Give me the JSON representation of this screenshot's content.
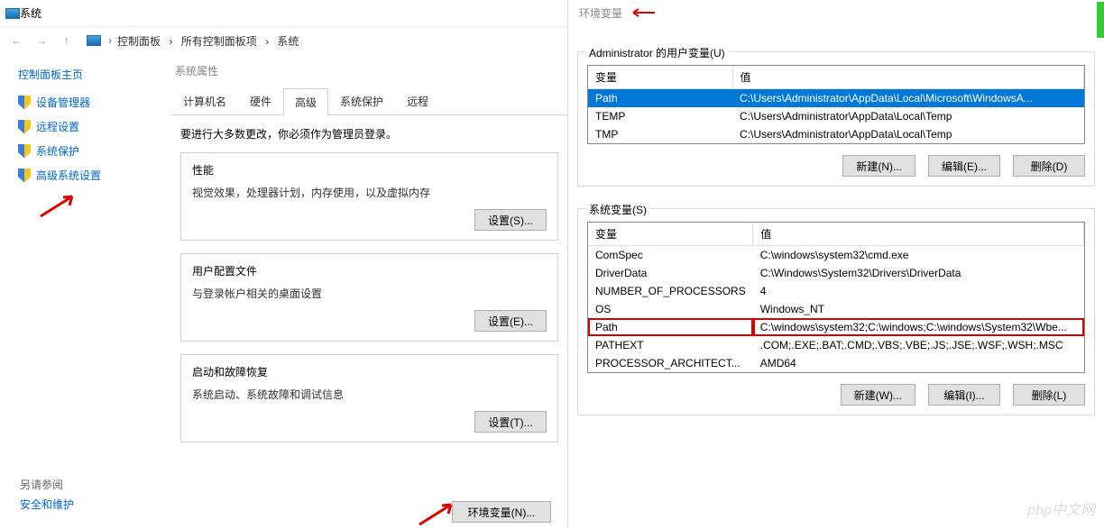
{
  "window": {
    "title": "系统"
  },
  "breadcrumb": {
    "items": [
      "控制面板",
      "所有控制面板项",
      "系统"
    ]
  },
  "sidebar": {
    "home": "控制面板主页",
    "items": [
      "设备管理器",
      "远程设置",
      "系统保护",
      "高级系统设置"
    ],
    "also_see": "另请参阅",
    "security": "安全和维护"
  },
  "props": {
    "title": "系统属性",
    "tabs": [
      "计算机名",
      "硬件",
      "高级",
      "系统保护",
      "远程"
    ],
    "active_tab": 2,
    "admin_note": "要进行大多数更改，你必须作为管理员登录。",
    "groups": [
      {
        "title": "性能",
        "desc": "视觉效果，处理器计划，内存使用，以及虚拟内存",
        "btn": "设置(S)..."
      },
      {
        "title": "用户配置文件",
        "desc": "与登录帐户相关的桌面设置",
        "btn": "设置(E)..."
      },
      {
        "title": "启动和故障恢复",
        "desc": "系统启动、系统故障和调试信息",
        "btn": "设置(T)..."
      }
    ],
    "envvar_btn": "环境变量(N)..."
  },
  "env": {
    "title": "环境变量",
    "user_label": "Administrator 的用户变量(U)",
    "sys_label": "系统变量(S)",
    "columns": [
      "变量",
      "值"
    ],
    "user_vars": [
      {
        "name": "Path",
        "value": "C:\\Users\\Administrator\\AppData\\Local\\Microsoft\\WindowsA...",
        "sel": true
      },
      {
        "name": "TEMP",
        "value": "C:\\Users\\Administrator\\AppData\\Local\\Temp"
      },
      {
        "name": "TMP",
        "value": "C:\\Users\\Administrator\\AppData\\Local\\Temp"
      }
    ],
    "sys_vars": [
      {
        "name": "ComSpec",
        "value": "C:\\windows\\system32\\cmd.exe"
      },
      {
        "name": "DriverData",
        "value": "C:\\Windows\\System32\\Drivers\\DriverData"
      },
      {
        "name": "NUMBER_OF_PROCESSORS",
        "value": "4"
      },
      {
        "name": "OS",
        "value": "Windows_NT"
      },
      {
        "name": "Path",
        "value": "C:\\windows\\system32;C:\\windows;C:\\windows\\System32\\Wbe...",
        "hl": true
      },
      {
        "name": "PATHEXT",
        "value": ".COM;.EXE;.BAT;.CMD;.VBS;.VBE;.JS;.JSE;.WSF;.WSH;.MSC"
      },
      {
        "name": "PROCESSOR_ARCHITECT...",
        "value": "AMD64"
      }
    ],
    "buttons": {
      "new_n": "新建(N)...",
      "edit_e": "编辑(E)...",
      "del_d": "删除(D)",
      "new_w": "新建(W)...",
      "edit_i": "编辑(I)...",
      "del_l": "删除(L)"
    }
  },
  "watermark": "php中文网"
}
